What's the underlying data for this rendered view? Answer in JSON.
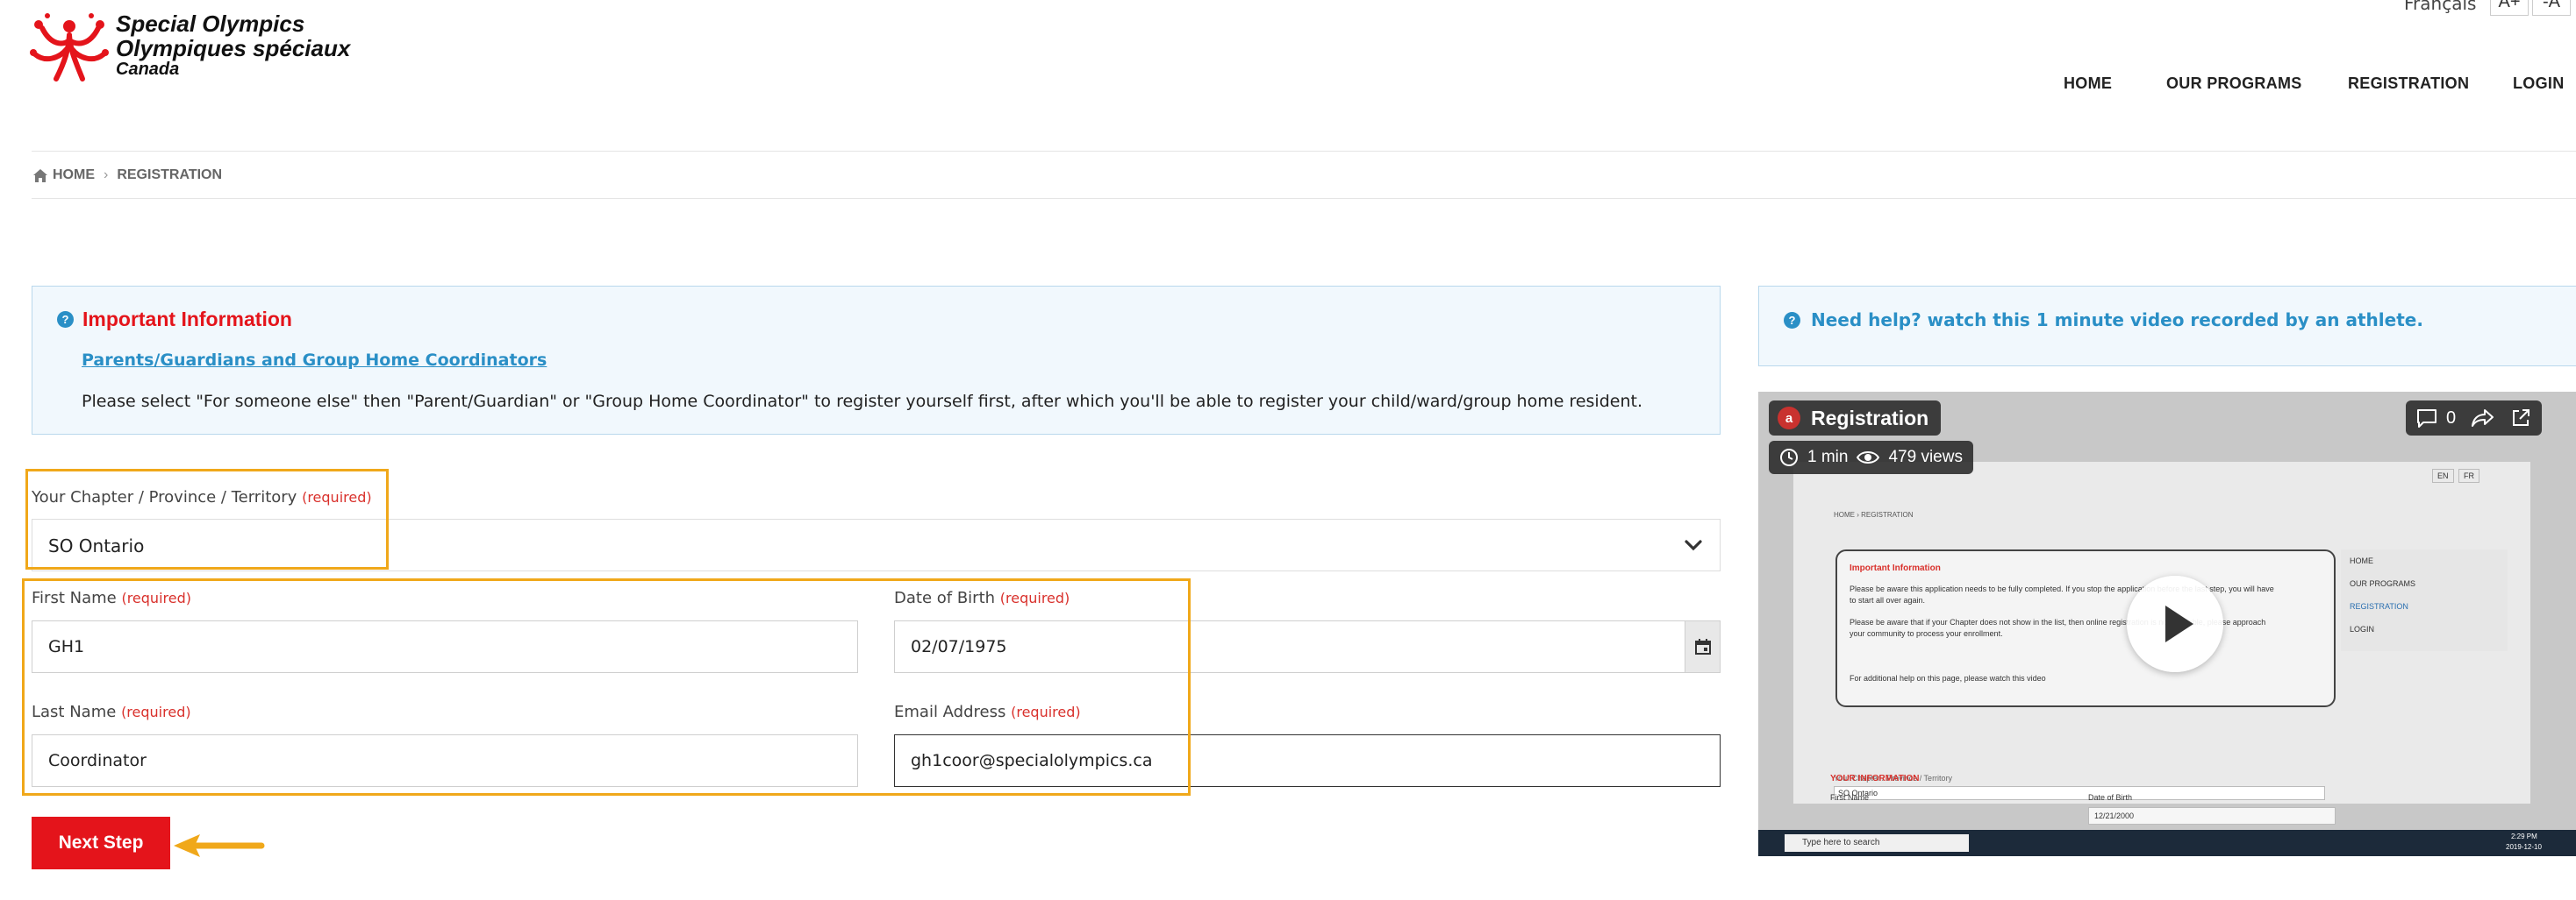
{
  "header": {
    "logo_lines": [
      "Special Olympics",
      "Olympiques spéciaux",
      "Canada"
    ],
    "language_link": "Français",
    "font_increase": "A+",
    "font_decrease": "-A",
    "nav": [
      "HOME",
      "OUR PROGRAMS",
      "REGISTRATION",
      "LOGIN"
    ]
  },
  "breadcrumb": {
    "home": "HOME",
    "current": "REGISTRATION"
  },
  "info_box": {
    "title": "Important Information",
    "link": "Parents/Guardians and Group Home Coordinators",
    "text": "Please select \"For someone else\" then \"Parent/Guardian\" or \"Group Home Coordinator\" to register yourself first, after which you'll be able to register your child/ward/group home resident."
  },
  "help_box": {
    "text": "Need help? watch this 1 minute video recorded by an athlete."
  },
  "form": {
    "required_text": "(required)",
    "chapter": {
      "label": "Your Chapter / Province / Territory",
      "value": "SO Ontario"
    },
    "first_name": {
      "label": "First Name",
      "value": "GH1"
    },
    "dob": {
      "label": "Date of Birth",
      "value": "02/07/1975"
    },
    "last_name": {
      "label": "Last Name",
      "value": "Coordinator"
    },
    "email": {
      "label": "Email Address",
      "value": "gh1coor@specialolympics.ca"
    },
    "next_button": "Next Step"
  },
  "video": {
    "avatar_letter": "a",
    "title": "Registration",
    "duration": "1 min",
    "views": "479 views",
    "comments": "0",
    "inner": {
      "lang_en": "EN",
      "lang_fr": "FR",
      "breadcrumb": "HOME › REGISTRATION",
      "panel_title": "Important Information",
      "panel_line1": "Please be aware this application needs to be fully completed.  If you stop the application before the last step, you will have",
      "panel_line2": "to start all over again.",
      "panel_line3": "Please be aware that if your Chapter does not show in the list, then online registration is not available, please approach",
      "panel_line4": "your community to process your enrollment.",
      "panel_line5": "For additional help on this page, please watch this video",
      "side_nav": [
        "HOME",
        "OUR PROGRAMS",
        "REGISTRATION",
        "LOGIN"
      ],
      "chapter_label": "Your Chapter / Province / Territory",
      "chapter_value": "SO Ontario",
      "section": "YOUR INFORMATION",
      "first_name": "First Name",
      "dob_label": "Date of Birth",
      "dob_value": "12/21/2000",
      "taskbar_search": "Type here to search",
      "clock_time": "2:29 PM",
      "clock_date": "2019-12-10"
    }
  },
  "colors": {
    "brand_red": "#e4141b",
    "link_blue": "#2a8fc6",
    "highlight_orange": "#f0a81a"
  }
}
